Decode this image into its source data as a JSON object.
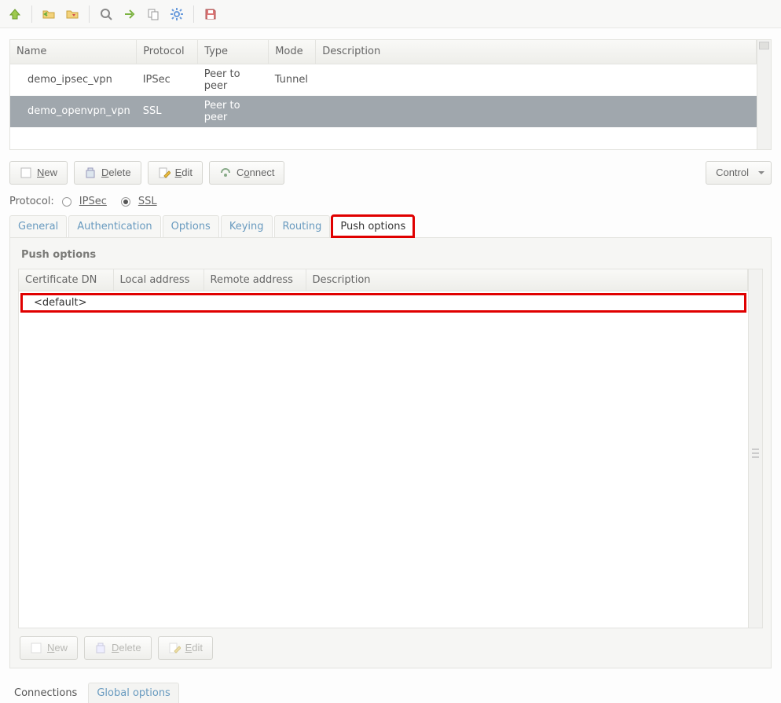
{
  "toolbar_icons": [
    "up",
    "folder-import",
    "folder-open",
    "search",
    "forward",
    "copy",
    "gear",
    "save"
  ],
  "vpn_columns": [
    "Name",
    "Protocol",
    "Type",
    "Mode",
    "Description"
  ],
  "vpn_rows": [
    {
      "name": "demo_ipsec_vpn",
      "protocol": "IPSec",
      "type": "Peer to peer",
      "mode": "Tunnel",
      "description": "",
      "selected": false
    },
    {
      "name": "demo_openvpn_vpn",
      "protocol": "SSL",
      "type": "Peer to peer",
      "mode": "",
      "description": "",
      "selected": true
    }
  ],
  "actions": {
    "new": "New",
    "delete": "Delete",
    "edit": "Edit",
    "connect": "Connect",
    "control": "Control"
  },
  "protocol": {
    "label": "Protocol:",
    "options": [
      {
        "label": "IPSec",
        "checked": false
      },
      {
        "label": "SSL",
        "checked": true
      }
    ]
  },
  "tabs": [
    "General",
    "Authentication",
    "Options",
    "Keying",
    "Routing",
    "Push options"
  ],
  "active_tab": "Push options",
  "push": {
    "title": "Push options",
    "columns": [
      "Certificate DN",
      "Local address",
      "Remote address",
      "Description"
    ],
    "rows": [
      {
        "cert": "<default>",
        "local": "",
        "remote": "",
        "description": ""
      }
    ],
    "actions": {
      "new": "New",
      "delete": "Delete",
      "edit": "Edit"
    }
  },
  "bottom_tabs": [
    "Connections",
    "Global options"
  ],
  "active_bottom_tab": "Connections"
}
